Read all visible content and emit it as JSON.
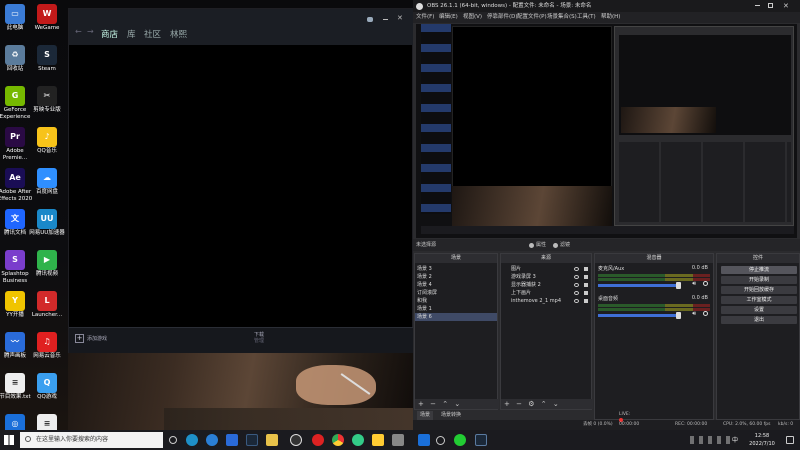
{
  "desktop_icons": [
    {
      "label": "此电脑",
      "color": "#3a7bd5",
      "glyph": "▭"
    },
    {
      "label": "WeGame",
      "color": "#c21a1a",
      "glyph": "W"
    },
    {
      "label": "回收站",
      "color": "#5b7c9c",
      "glyph": "♻"
    },
    {
      "label": "Steam",
      "color": "#1b2838",
      "glyph": "S"
    },
    {
      "label": "GeForce Experience",
      "color": "#76b900",
      "glyph": "G"
    },
    {
      "label": "剪映专业版",
      "color": "#222222",
      "glyph": "✂"
    },
    {
      "label": "Adobe Premie...",
      "color": "#2a0a44",
      "glyph": "Pr"
    },
    {
      "label": "QQ音乐",
      "color": "#f7c31a",
      "glyph": "♪"
    },
    {
      "label": "Adobe After Effects 2020",
      "color": "#1a0d55",
      "glyph": "Ae"
    },
    {
      "label": "百度网盘",
      "color": "#2f8fff",
      "glyph": "☁"
    },
    {
      "label": "腾讯文档",
      "color": "#1f66ff",
      "glyph": "文"
    },
    {
      "label": "网易UU加速器",
      "color": "#1a88c9",
      "glyph": "UU"
    },
    {
      "label": "Splashtop Business",
      "color": "#7a3dcc",
      "glyph": "S"
    },
    {
      "label": "腾讯视频",
      "color": "#2fb34b",
      "glyph": "▶"
    },
    {
      "label": "YY开播",
      "color": "#f0c400",
      "glyph": "Y"
    },
    {
      "label": "Launcher...",
      "color": "#d22a2a",
      "glyph": "L"
    },
    {
      "label": "腾声画板",
      "color": "#2a6bd9",
      "glyph": "〰"
    },
    {
      "label": "网易云音乐",
      "color": "#e02020",
      "glyph": "♫"
    },
    {
      "label": "节目效果.txt",
      "color": "#eeeeee",
      "glyph": "≡"
    },
    {
      "label": "QQ游戏",
      "color": "#3a9ff0",
      "glyph": "Q"
    },
    {
      "label": "抖音Live直播_助手最新版",
      "color": "#1a6fd9",
      "glyph": "◎"
    },
    {
      "label": "贴吧.txt",
      "color": "#eeeeee",
      "glyph": "≡"
    }
  ],
  "steam": {
    "nav": [
      "商店",
      "库",
      "社区",
      "林熙"
    ],
    "add_game": "添加游戏",
    "download_label": "下载",
    "download_sub": "管理",
    "friends": "好友与聊天"
  },
  "obs": {
    "title": "OBS 26.1.1 (64-bit, windows) - 配置文件: 未命名 - 场景: 未命名",
    "menu": [
      "文件(F)",
      "编辑(E)",
      "视图(V)",
      "停靠部件(D)",
      "配置文件(P)",
      "场景集合(S)",
      "工具(T)",
      "帮助(H)"
    ],
    "scene_toolbar": {
      "left": "未选择源",
      "right": [
        "属性",
        "滤镜"
      ]
    },
    "panels": {
      "scenes": {
        "title": "场景",
        "items": [
          "场景 3",
          "场景 2",
          "场景 4",
          "订阅滚屏",
          "和我",
          "场景 1",
          "场景 6"
        ],
        "selected": 6
      },
      "sources": {
        "title": "来源",
        "items": [
          "图片",
          "游戏录屏 3",
          "显示器捕获 2",
          "上下画片",
          "inthemove 2_1 mp4"
        ]
      },
      "mixer": {
        "title": "混音器",
        "tracks": [
          {
            "name": "麦克风/Aux",
            "db": "0.0 dB"
          },
          {
            "name": "桌面音频",
            "db": "0.0 dB"
          }
        ]
      },
      "controls": {
        "title": "控件",
        "buttons": [
          "停止推流",
          "开始录制",
          "开始回放缓存",
          "工作室模式",
          "设置",
          "退出"
        ]
      }
    },
    "tabs": [
      "场景",
      "场景转换"
    ],
    "status": {
      "drop": "丢帧 0 (0.0%)",
      "live": "LIVE: 00:00:00",
      "rec": "REC: 00:00:00",
      "cpu": "CPU: 2.0%, 60.00 fps",
      "kbps": "kb/s: 0"
    }
  },
  "taskbar": {
    "search_placeholder": "在这里输入你要搜索的内容",
    "time": "12:58",
    "date": "2022/7/10",
    "ime": "中"
  }
}
